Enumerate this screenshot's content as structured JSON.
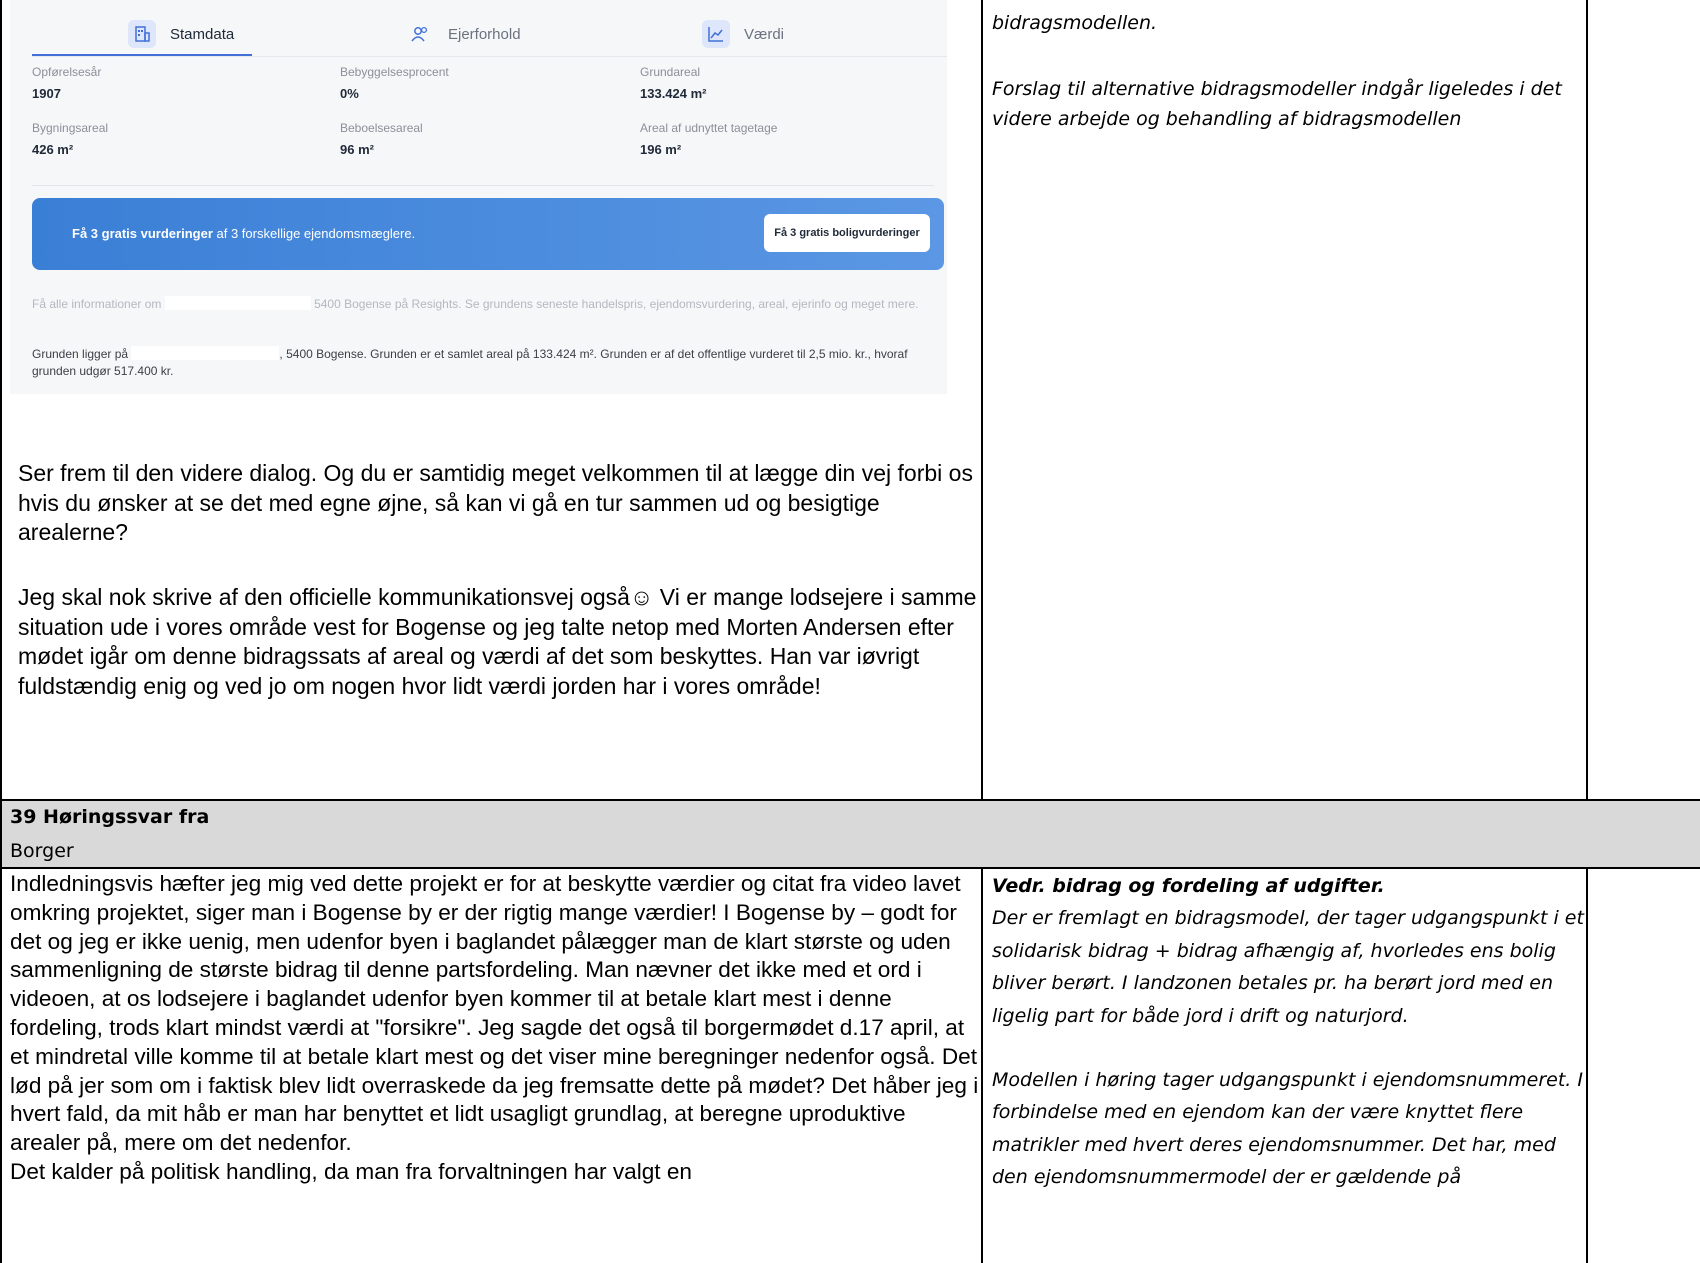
{
  "screenshot": {
    "tabs": [
      {
        "label": "Stamdata",
        "icon": "building-icon"
      },
      {
        "label": "Ejerforhold",
        "icon": "people-icon"
      },
      {
        "label": "Værdi",
        "icon": "chart-line-icon"
      }
    ],
    "stats": [
      {
        "label": "Opførelsesår",
        "value": "1907"
      },
      {
        "label": "Bebyggelsesprocent",
        "value": "0%"
      },
      {
        "label": "Grundareal",
        "value": "133.424 m²"
      },
      {
        "label": "Bygningsareal",
        "value": "426 m²"
      },
      {
        "label": "Beboelsesareal",
        "value": "96 m²"
      },
      {
        "label": "Areal af udnyttet tagetage",
        "value": "196 m²"
      }
    ],
    "banner": {
      "bold": "Få 3 gratis vurderinger",
      "rest": " af 3 forskellige ejendomsmæglere.",
      "button": "Få 3 gratis boligvurderinger"
    },
    "info_gray_a": "Få alle informationer om",
    "info_gray_b": "5400 Bogense på Resights. Se grundens seneste handelspris, ejendomsvurdering, areal, ejerinfo og meget mere.",
    "info_dark_a": "Grunden ligger på",
    "info_dark_b": ", 5400 Bogense. Grunden er et samlet areal på 133.424 m². Grunden er af det offentlige vurderet til 2,5 mio. kr., hvoraf grunden udgør 517.400 kr."
  },
  "letter": {
    "p1": "Ser frem til den videre dialog. Og du er samtidig meget velkommen til at lægge din vej forbi os hvis du ønsker at se det med egne øjne, så kan vi gå en tur sammen ud og besigtige arealerne?",
    "p2": "Jeg skal nok skrive af den officielle kommunikationsvej også☺ Vi er mange lodsejere i samme situation ude i vores område vest for Bogense og jeg talte netop med Morten Andersen efter mødet igår om denne bidragssats af areal og værdi af det som beskyttes. Han var iøvrigt fuldstændig enig og ved jo om nogen hvor lidt værdi jorden har i vores område!"
  },
  "response1": {
    "line1": "bidragsmodellen.",
    "line2": "Forslag til alternative bidragsmodeller indgår ligeledes i det videre arbejde og behandling af bidragsmodellen"
  },
  "section": {
    "title": "39 Høringssvar fra",
    "subtitle": "Borger"
  },
  "section_body": "Indledningsvis hæfter jeg mig ved dette projekt er for at beskytte værdier og citat fra video lavet omkring projektet, siger man i Bogense by er der rigtig mange værdier! I Bogense by – godt for det og jeg er ikke uenig, men udenfor byen i baglandet pålægger man de klart største og uden sammenligning de største bidrag til denne partsfordeling. Man nævner det ikke med et ord i videoen, at os lodsejere i baglandet udenfor byen kommer til at betale klart mest i denne fordeling, trods klart mindst værdi at \"forsikre\". Jeg sagde det også til borgermødet d.17 april, at et mindretal ville komme til at betale klart mest og det viser mine beregninger nedenfor også. Det lød på jer som om i faktisk blev lidt overraskede da jeg fremsatte dette på mødet? Det håber jeg i hvert fald, da mit håb er man har benyttet et lidt usagligt grundlag, at beregne uproduktive arealer på, mere om det nedenfor.\nDet kalder på politisk handling, da man fra forvaltningen har valgt en",
  "response2": {
    "heading": "Vedr. bidrag og fordeling af udgifter.",
    "p1": "Der er fremlagt en bidragsmodel, der tager udgangspunkt i et solidarisk bidrag + bidrag afhængig af, hvorledes ens bolig bliver berørt. I landzonen betales pr. ha berørt jord med en ligelig part for både jord i drift og naturjord.",
    "p2": "Modellen i høring tager udgangspunkt i ejendomsnummeret. I forbindelse med en ejendom kan der være knyttet flere matrikler med hvert deres ejendomsnummer. Det har, med den ejendomsnummermodel der er gældende på"
  }
}
